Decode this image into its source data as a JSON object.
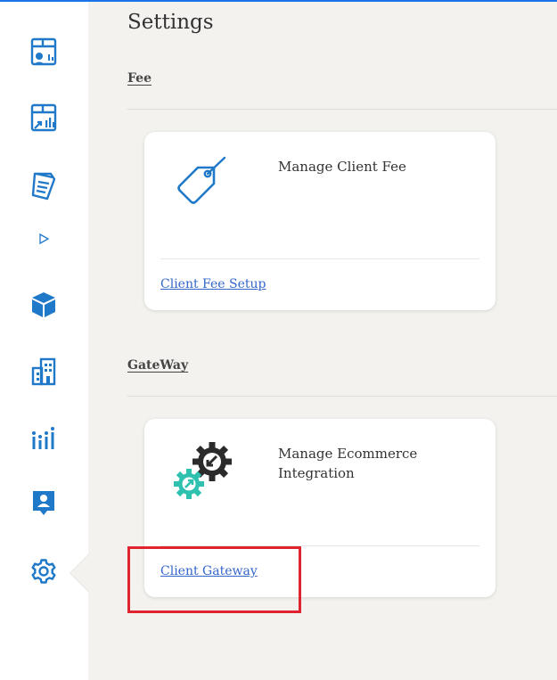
{
  "page": {
    "title": "Settings"
  },
  "sidebar": {
    "items": [
      {
        "icon": "client-dashboard-icon"
      },
      {
        "icon": "reports-icon"
      },
      {
        "icon": "documents-icon"
      },
      {
        "icon": "expand-arrow-icon"
      },
      {
        "icon": "product-box-icon"
      },
      {
        "icon": "building-icon"
      },
      {
        "icon": "analytics-icon"
      },
      {
        "icon": "user-contact-icon"
      },
      {
        "icon": "settings-gear-icon",
        "active": true
      }
    ]
  },
  "sections": [
    {
      "title": "Fee",
      "card": {
        "icon": "price-tag-icon",
        "title": "Manage Client Fee",
        "link": "Client Fee Setup"
      }
    },
    {
      "title": "GateWay",
      "card": {
        "icon": "integration-gears-icon",
        "title": "Manage Ecommerce Integration",
        "link": "Client Gateway"
      }
    }
  ],
  "colors": {
    "accent": "#1a73e8",
    "link": "#3366cc",
    "highlight": "#e0242f",
    "gear_dark": "#2b2b2b",
    "gear_teal": "#2fc1b0"
  }
}
